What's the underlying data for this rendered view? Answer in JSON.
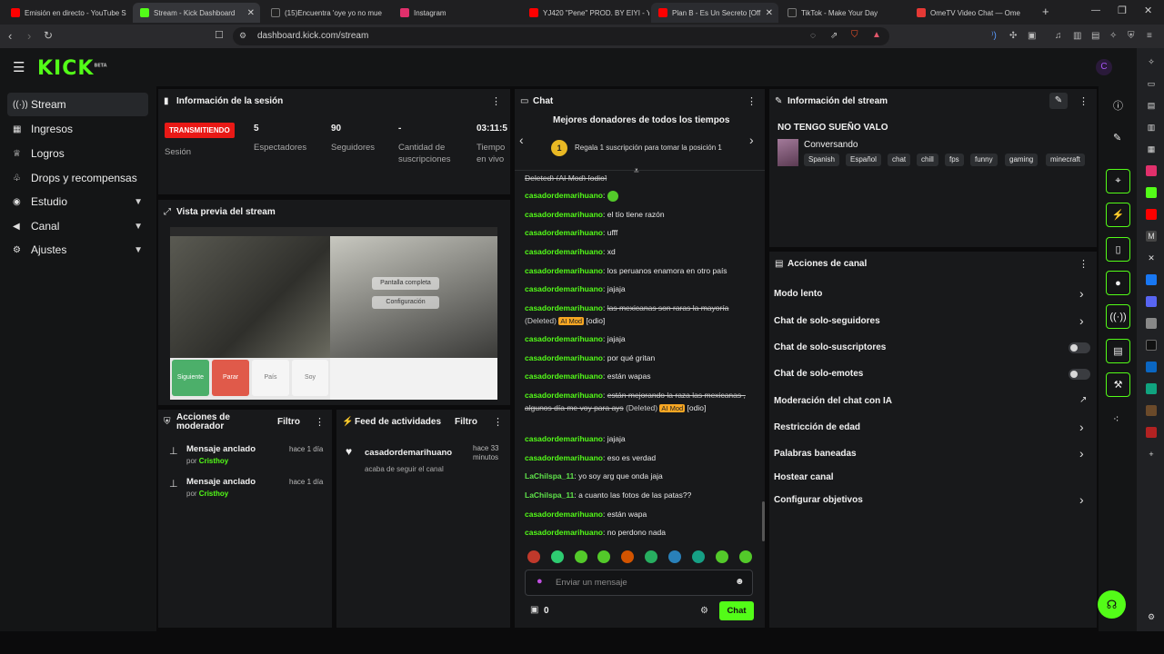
{
  "browser": {
    "tabs": [
      {
        "label": "Emisión en directo - YouTube S",
        "fav": "#ff0000"
      },
      {
        "label": "Stream - Kick Dashboard",
        "fav": "#53fc18"
      },
      {
        "label": "(15)Encuentra 'oye yo no mue",
        "fav": "#111111"
      },
      {
        "label": "Instagram",
        "fav": "#e1306c"
      },
      {
        "label": "YJ420 \"Pene\" PROD. BY EIYI - Y",
        "fav": "#ff0000"
      },
      {
        "label": "Plan B - Es Un Secreto [Off",
        "fav": "#ff0000"
      },
      {
        "label": "TikTok - Make Your Day",
        "fav": "#111111"
      },
      {
        "label": "OmeTV Video Chat — Ome",
        "fav": "#e53935"
      }
    ],
    "url": "dashboard.kick.com/stream"
  },
  "header": {
    "logo": "KICK",
    "logo_badge": "BETA"
  },
  "sidebar": {
    "items": [
      {
        "label": "Stream",
        "icon": "broadcast-icon"
      },
      {
        "label": "Ingresos",
        "icon": "bank-icon"
      },
      {
        "label": "Logros",
        "icon": "trophy-icon"
      },
      {
        "label": "Drops y recompensas",
        "icon": "gift-icon"
      },
      {
        "label": "Estudio",
        "icon": "studio-icon"
      },
      {
        "label": "Canal",
        "icon": "megaphone-icon"
      },
      {
        "label": "Ajustes",
        "icon": "gear-icon"
      }
    ]
  },
  "session": {
    "title": "Información de la sesión",
    "live_badge": "TRANSMITIENDO",
    "session_label": "Sesión",
    "stats": [
      {
        "value": "5",
        "label": "Espectadores"
      },
      {
        "value": "90",
        "label": "Seguidores"
      },
      {
        "value": "-",
        "label": "Cantidad de suscripciones"
      },
      {
        "value": "03:11:5",
        "label": "Tiempo en vivo"
      }
    ]
  },
  "preview": {
    "title": "Vista previa del stream",
    "overlay_top": "Pantalla completa",
    "overlay_bottom": "Configuración",
    "buttons": [
      "Siguiente",
      "Parar",
      "País",
      "Soy"
    ]
  },
  "mod_actions": {
    "title": "Acciones de moderador",
    "filter": "Filtro",
    "items": [
      {
        "title": "Mensaje anclado",
        "by_prefix": "por",
        "by": "Cristhoy",
        "time": "hace 1 día"
      },
      {
        "title": "Mensaje anclado",
        "by_prefix": "por",
        "by": "Cristhoy",
        "time": "hace 1 día"
      }
    ]
  },
  "activity": {
    "title": "Feed de actividades",
    "filter": "Filtro",
    "items": [
      {
        "user": "casadordemarihuano",
        "text": "acaba de seguir el canal",
        "time": "hace 33 minutos"
      }
    ]
  },
  "chat": {
    "title": "Chat",
    "donors_title": "Mejores donadores de todos los tiempos",
    "rank": "1",
    "donors_text": "Regala 1 suscripción para tomar la posición 1",
    "top_partial": "Deleted) (AI Mod) [odio]",
    "messages": [
      {
        "user": "casadordemarihuano",
        "text": ""
      },
      {
        "user": "casadordemarihuano",
        "text": "el tío tiene razón"
      },
      {
        "user": "casadordemarihuano",
        "text": "ufff"
      },
      {
        "user": "casadordemarihuano",
        "text": "xd"
      },
      {
        "user": "casadordemarihuano",
        "text": "los peruanos enamora en otro país"
      },
      {
        "user": "casadordemarihuano",
        "text": "jajaja"
      },
      {
        "user": "casadordemarihuano",
        "text": "las mexicanas son raras la mayoría",
        "deleted": "(Deleted)",
        "aimod": "AI Mod",
        "reason": "[odio]"
      },
      {
        "user": "casadordemarihuano",
        "text": "jajaja"
      },
      {
        "user": "casadordemarihuano",
        "text": "por qué gritan"
      },
      {
        "user": "casadordemarihuano",
        "text": "están wapas"
      },
      {
        "user": "casadordemarihuano",
        "text": "están mejorando la raza las mexicanas , algunos día me voy para ays",
        "deleted": "(Deleted)",
        "aimod": "AI Mod",
        "reason": "[odio]"
      },
      {
        "user": "casadordemarihuano",
        "text": "jajaja"
      },
      {
        "user": "casadordemarihuano",
        "text": "eso es verdad"
      },
      {
        "user": "LaChilspa_11",
        "text": "yo soy arg que onda jaja"
      },
      {
        "user": "LaChilspa_11",
        "text": "a cuanto las fotos de las patas??"
      },
      {
        "user": "casadordemarihuano",
        "text": "están wapa"
      },
      {
        "user": "casadordemarihuano",
        "text": "no perdono nada"
      }
    ],
    "input_placeholder": "Enviar un mensaje",
    "points": "0",
    "send_label": "Chat"
  },
  "stream_info": {
    "title": "Información del stream",
    "stream_title": "NO TENGO SUEÑO VALO",
    "category": "Conversando",
    "tags": [
      "Spanish",
      "Español",
      "chat",
      "chill",
      "fps",
      "funny",
      "gaming",
      "minecraft"
    ]
  },
  "channel_actions": {
    "title": "Acciones de canal",
    "items": [
      {
        "label": "Modo lento",
        "control": "chevron"
      },
      {
        "label": "Chat de solo-seguidores",
        "control": "chevron"
      },
      {
        "label": "Chat de solo-suscriptores",
        "control": "toggle"
      },
      {
        "label": "Chat de solo-emotes",
        "control": "toggle"
      },
      {
        "label": "Moderación del chat con IA",
        "control": "external"
      },
      {
        "label": "Restricción de edad",
        "control": "chevron"
      },
      {
        "label": "Palabras baneadas",
        "control": "chevron"
      },
      {
        "label": "Hostear canal",
        "control": "none"
      },
      {
        "label": "Configurar objetivos",
        "control": "chevron"
      }
    ]
  },
  "colors": {
    "accent": "#53fc18",
    "live": "#e91916",
    "aimod": "#f6a623"
  }
}
